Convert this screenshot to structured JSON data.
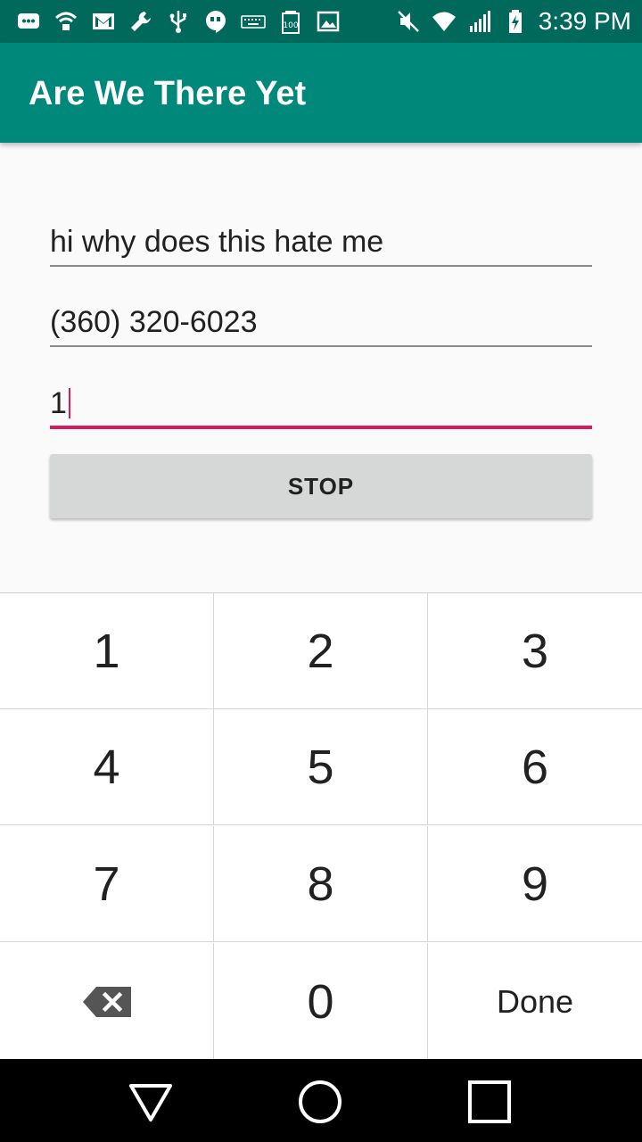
{
  "status_bar": {
    "time": "3:39 PM",
    "left_icons": [
      "chat-icon",
      "wifi-lock-icon",
      "gmail-icon",
      "wrench-icon",
      "usb-icon",
      "hangouts-icon",
      "keyboard-icon",
      "battery-100-icon",
      "image-icon"
    ],
    "right_icons": [
      "mute-icon",
      "wifi-icon",
      "signal-icon",
      "battery-charging-icon"
    ]
  },
  "app_bar": {
    "title": "Are We There Yet"
  },
  "form": {
    "message_value": "hi why does this hate me",
    "phone_value": "(360) 320-6023",
    "minutes_value": "1",
    "stop_label": "STOP"
  },
  "keypad": {
    "keys": [
      "1",
      "2",
      "3",
      "4",
      "5",
      "6",
      "7",
      "8",
      "9",
      "0"
    ],
    "done_label": "Done"
  },
  "colors": {
    "status_bar": "#00695c",
    "app_bar": "#00897b",
    "accent": "#d81b60",
    "button": "#d6d7d7"
  }
}
